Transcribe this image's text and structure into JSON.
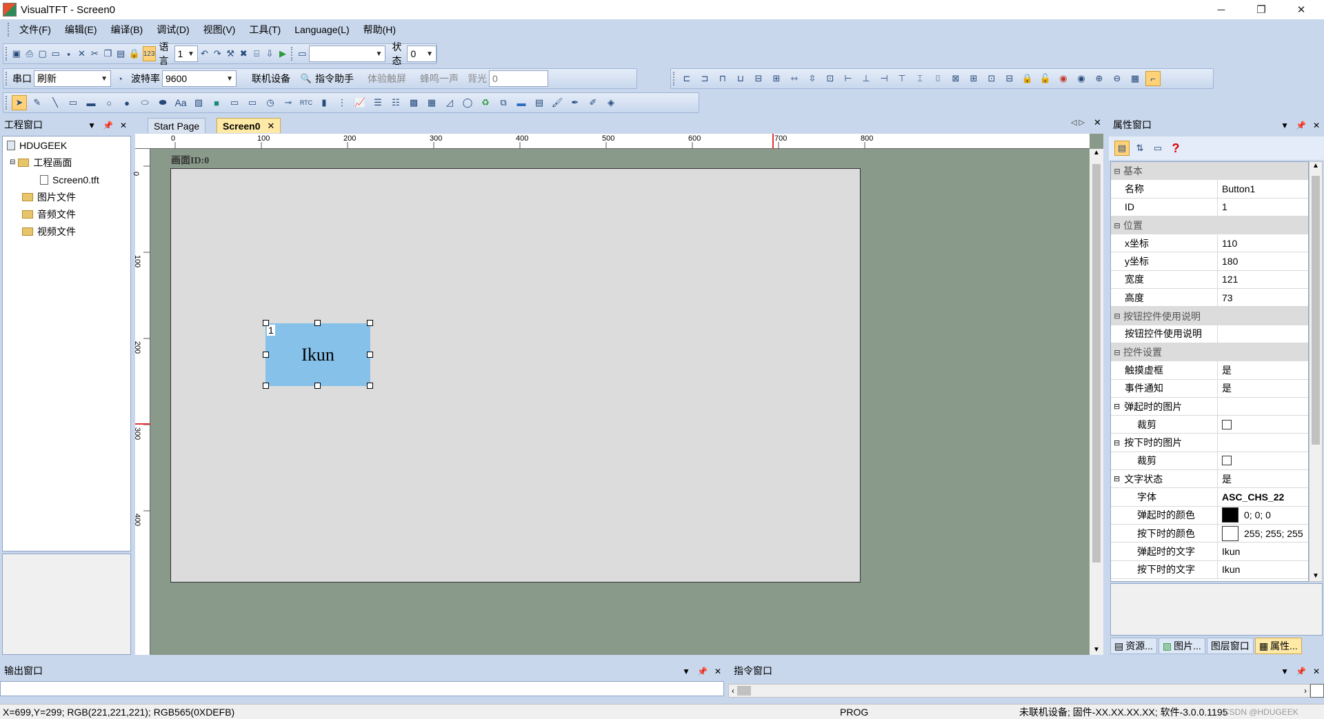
{
  "window": {
    "title": "VisualTFT - Screen0",
    "minimize": "─",
    "restore": "❐",
    "close": "✕"
  },
  "menu": [
    "文件(F)",
    "编辑(E)",
    "编译(B)",
    "调试(D)",
    "视图(V)",
    "工具(T)",
    "Language(L)",
    "帮助(H)"
  ],
  "toolbar1": {
    "lang_label": "语言",
    "lang_value": "1",
    "state_label": "状态",
    "state_value": "0",
    "screen_combo": ""
  },
  "toolbar2": {
    "port_label": "串口",
    "port_value": "刷新",
    "baud_label": "波特率",
    "baud_value": "9600",
    "connect": "联机设备",
    "cmd_helper": "指令助手",
    "touch": "体验触屏",
    "beep": "蜂鸣一声",
    "backlight_label": "背光",
    "backlight_value": "0"
  },
  "project_panel": {
    "title": "工程窗口",
    "root": "HDUGEEK",
    "items": [
      {
        "label": "工程画面"
      },
      {
        "label": "Screen0.tft"
      },
      {
        "label": "图片文件"
      },
      {
        "label": "音频文件"
      },
      {
        "label": "视频文件"
      }
    ]
  },
  "editor": {
    "tabs": [
      {
        "label": "Start Page"
      },
      {
        "label": "Screen0"
      }
    ],
    "ruler_h": [
      "0",
      "100",
      "200",
      "300",
      "400",
      "500",
      "600",
      "700",
      "800"
    ],
    "ruler_v": [
      "0",
      "100",
      "200",
      "300",
      "400"
    ],
    "screen_label": "画面ID:0",
    "button_id": "1",
    "button_text": "Ikun"
  },
  "props_panel": {
    "title": "属性窗口",
    "cat_basic": "基本",
    "name_k": "名称",
    "name_v": "Button1",
    "id_k": "ID",
    "id_v": "1",
    "cat_pos": "位置",
    "x_k": "x坐标",
    "x_v": "110",
    "y_k": "y坐标",
    "y_v": "180",
    "w_k": "宽度",
    "w_v": "121",
    "h_k": "高度",
    "h_v": "73",
    "cat_btnhelp": "按钮控件使用说明",
    "btnhelp_k": "按钮控件使用说明",
    "cat_ctrl": "控件设置",
    "touch_k": "触摸虚框",
    "touch_v": "是",
    "event_k": "事件通知",
    "event_v": "是",
    "upimg_k": "弹起时的图片",
    "crop1_k": "裁剪",
    "downimg_k": "按下时的图片",
    "crop2_k": "裁剪",
    "textstate_k": "文字状态",
    "textstate_v": "是",
    "font_k": "字体",
    "font_v": "ASC_CHS_22",
    "upcolor_k": "弹起时的颜色",
    "upcolor_v": "0; 0; 0",
    "downcolor_k": "按下时的颜色",
    "downcolor_v": "255; 255; 255",
    "uptext_k": "弹起时的文字",
    "uptext_v": "Ikun",
    "downtext_k": "按下时的文字",
    "downtext_v": "Ikun",
    "help_q": "?"
  },
  "bottom_tabs": [
    "资源...",
    "图片...",
    "图层窗口",
    "属性..."
  ],
  "output_panel": {
    "title": "输出窗口"
  },
  "cmd_panel": {
    "title": "指令窗口"
  },
  "status": {
    "coords": "X=699,Y=299; RGB(221,221,221); RGB565(0XDEFB)",
    "mode": "PROG",
    "device": "未联机设备; 固件-XX.XX.XX.XX; 软件-3.0.0.1195",
    "watermark": "CSDN @HDUGEEK"
  },
  "colors": {
    "accent_tab": "#ffe9a6",
    "button_fill": "#85c1e9",
    "canvas_bg": "#8a9a8a",
    "screen_bg": "#dcdcdc"
  }
}
